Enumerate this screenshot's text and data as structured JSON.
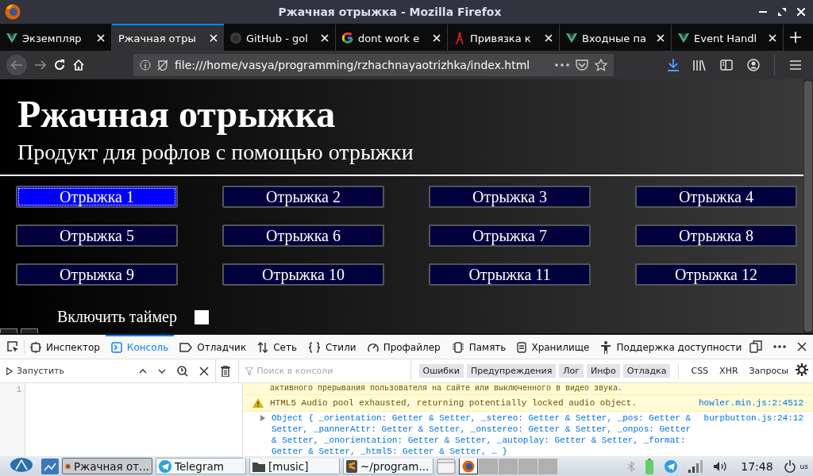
{
  "window": {
    "title": "Ржачная отрыжка - Mozilla Firefox"
  },
  "tabs": [
    {
      "label": "Экземпляр",
      "kind": "vue",
      "selected": false
    },
    {
      "label": "Ржачная отры",
      "selected": true
    },
    {
      "label": "GitHub - gol",
      "kind": "github",
      "selected": false
    },
    {
      "label": "dont work e",
      "kind": "google",
      "selected": false
    },
    {
      "label": "Привязка к",
      "kind": "tower",
      "selected": false
    },
    {
      "label": "Входные па",
      "kind": "vue",
      "selected": false
    },
    {
      "label": "Event Handl",
      "kind": "vue",
      "selected": false
    }
  ],
  "address_bar": {
    "url": "file:///home/vasya/programming/rzhachnayaotrizhka/index.html"
  },
  "page": {
    "title": "Ржачная отрыжка",
    "subtitle": "Продукт для рофлов с помощью отрыжки",
    "buttons": [
      {
        "label": "Отрыжка 1",
        "selected": true
      },
      {
        "label": "Отрыжка 2",
        "selected": false
      },
      {
        "label": "Отрыжка 3",
        "selected": false
      },
      {
        "label": "Отрыжка 4",
        "selected": false
      },
      {
        "label": "Отрыжка 5",
        "selected": false
      },
      {
        "label": "Отрыжка 6",
        "selected": false
      },
      {
        "label": "Отрыжка 7",
        "selected": false
      },
      {
        "label": "Отрыжка 8",
        "selected": false
      },
      {
        "label": "Отрыжка 9",
        "selected": false
      },
      {
        "label": "Отрыжка 10",
        "selected": false
      },
      {
        "label": "Отрыжка 11",
        "selected": false
      },
      {
        "label": "Отрыжка 12",
        "selected": false
      }
    ],
    "timer": {
      "label": "Включить таймер",
      "checked": false
    }
  },
  "devtools": {
    "tabs": [
      {
        "label": "Инспектор",
        "kind": "inspector",
        "selected": false
      },
      {
        "label": "Консоль",
        "kind": "console",
        "selected": true
      },
      {
        "label": "Отладчик",
        "kind": "debugger",
        "selected": false
      },
      {
        "label": "Сеть",
        "kind": "network",
        "selected": false
      },
      {
        "label": "Стили",
        "kind": "styles",
        "selected": false
      },
      {
        "label": "Профайлер",
        "kind": "profiler",
        "selected": false
      },
      {
        "label": "Память",
        "kind": "memory",
        "selected": false
      },
      {
        "label": "Хранилище",
        "kind": "storage",
        "selected": false
      },
      {
        "label": "Поддержка доступности",
        "kind": "accessibility",
        "selected": false
      }
    ],
    "run_button": "Запустить",
    "editor": {
      "line_numbers": [
        "1"
      ]
    },
    "search": {
      "placeholder": "Поиск в консоли"
    },
    "filters": [
      {
        "label": "Ошибки",
        "on": true
      },
      {
        "label": "Предупреждения",
        "on": true
      },
      {
        "label": "Лог",
        "on": true
      },
      {
        "label": "Инфо",
        "on": true
      },
      {
        "label": "Отладка",
        "on": true
      },
      {
        "label": "CSS",
        "on": false
      },
      {
        "label": "XHR",
        "on": false
      },
      {
        "label": "Запросы",
        "on": false
      }
    ],
    "messages": [
      {
        "kind": "warning_tail",
        "text": "активного прерывания пользователя на сайте или выключенного в видео звука."
      },
      {
        "kind": "warning",
        "text": "HTML5 Audio pool exhausted, returning potentially locked audio object.",
        "source": "howler.min.js:2:4512"
      },
      {
        "kind": "object",
        "text": "Object { _orientation: Getter & Setter, _stereo: Getter & Setter, _pos: Getter & Setter, _pannerAttr: Getter & Setter, _onstereo: Getter & Setter, _onpos: Getter & Setter, _onorientation: Getter & Setter, _autoplay: Getter & Setter, _format: Getter & Setter, _html5: Getter & Setter, … }",
        "source": "burpbutton.js:24:12"
      }
    ]
  },
  "taskbar": {
    "tasks": [
      {
        "label": "Ржачная от...",
        "kind": "firefox",
        "selected": true
      },
      {
        "label": "Telegram",
        "kind": "telegram",
        "selected": false
      },
      {
        "label": "[music]",
        "kind": "folder",
        "selected": false
      },
      {
        "label": "~/program...",
        "kind": "sublime",
        "selected": false
      }
    ],
    "clock": "17:48",
    "layout": "us"
  }
}
